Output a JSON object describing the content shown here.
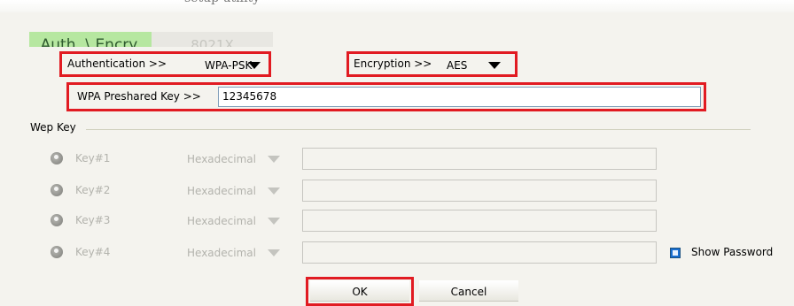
{
  "header": {
    "clip_text": "setup utility"
  },
  "tabs": [
    {
      "label": "Auth. \\ Encry."
    },
    {
      "label": "8021X"
    }
  ],
  "auth": {
    "authentication_label": "Authentication >>",
    "authentication_value": "WPA-PSK",
    "encryption_label": "Encryption >>",
    "encryption_value": "AES",
    "psk_label": "WPA Preshared Key >>",
    "psk_value": "12345678"
  },
  "wep": {
    "group_label": "Wep Key",
    "keys": [
      {
        "label": "Key#1",
        "format": "Hexadecimal",
        "value": ""
      },
      {
        "label": "Key#2",
        "format": "Hexadecimal",
        "value": ""
      },
      {
        "label": "Key#3",
        "format": "Hexadecimal",
        "value": ""
      },
      {
        "label": "Key#4",
        "format": "Hexadecimal",
        "value": ""
      }
    ],
    "show_password_label": "Show Password"
  },
  "buttons": {
    "ok": "OK",
    "cancel": "Cancel"
  },
  "colors": {
    "highlight": "#e11b22",
    "active_tab": "#b6e7a0",
    "panel": "#f4f3ee"
  }
}
